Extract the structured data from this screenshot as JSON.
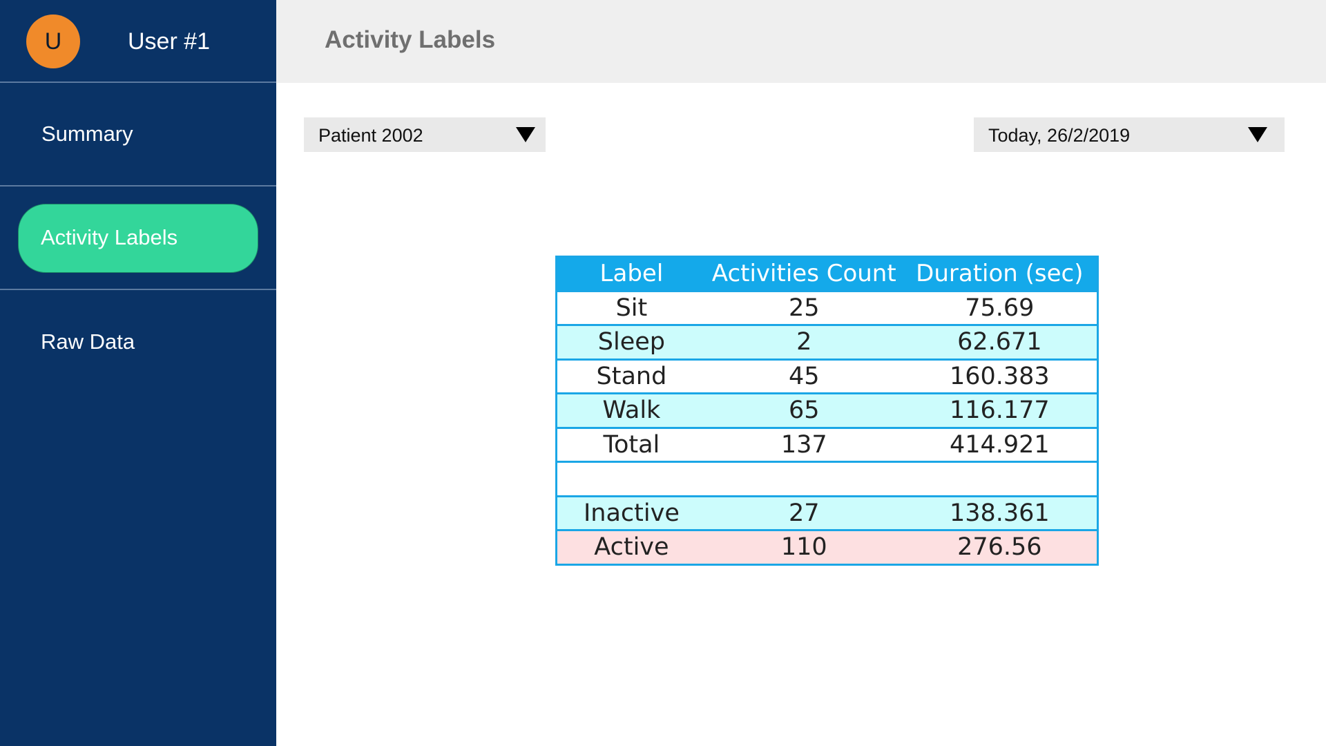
{
  "user": {
    "avatar_letter": "U",
    "name": "User #1",
    "avatar_color": "#f08a2a"
  },
  "sidebar": {
    "background": "#0a3366",
    "items": [
      {
        "label": "Summary",
        "active": false
      },
      {
        "label": "Activity Labels",
        "active": true,
        "highlight_color": "#33d69a"
      },
      {
        "label": "Raw Data",
        "active": false
      }
    ]
  },
  "header": {
    "title": "Activity Labels"
  },
  "filters": {
    "patient": "Patient 2002",
    "date": "Today, 26/2/2019"
  },
  "table": {
    "headers": [
      "Label",
      "Activities Count",
      "Duration (sec)"
    ],
    "header_color": "#14a9ea",
    "rows": [
      {
        "label": "Sit",
        "count": "25",
        "duration": "75.69",
        "style": "white"
      },
      {
        "label": "Sleep",
        "count": "2",
        "duration": "62.671",
        "style": "cyan"
      },
      {
        "label": "Stand",
        "count": "45",
        "duration": "160.383",
        "style": "white"
      },
      {
        "label": "Walk",
        "count": "65",
        "duration": "116.177",
        "style": "cyan"
      },
      {
        "label": "Total",
        "count": "137",
        "duration": "414.921",
        "style": "white"
      },
      {
        "label": "",
        "count": "",
        "duration": "",
        "style": "white"
      },
      {
        "label": "Inactive",
        "count": "27",
        "duration": "138.361",
        "style": "cyan"
      },
      {
        "label": "Active",
        "count": "110",
        "duration": "276.56",
        "style": "pink"
      }
    ]
  }
}
